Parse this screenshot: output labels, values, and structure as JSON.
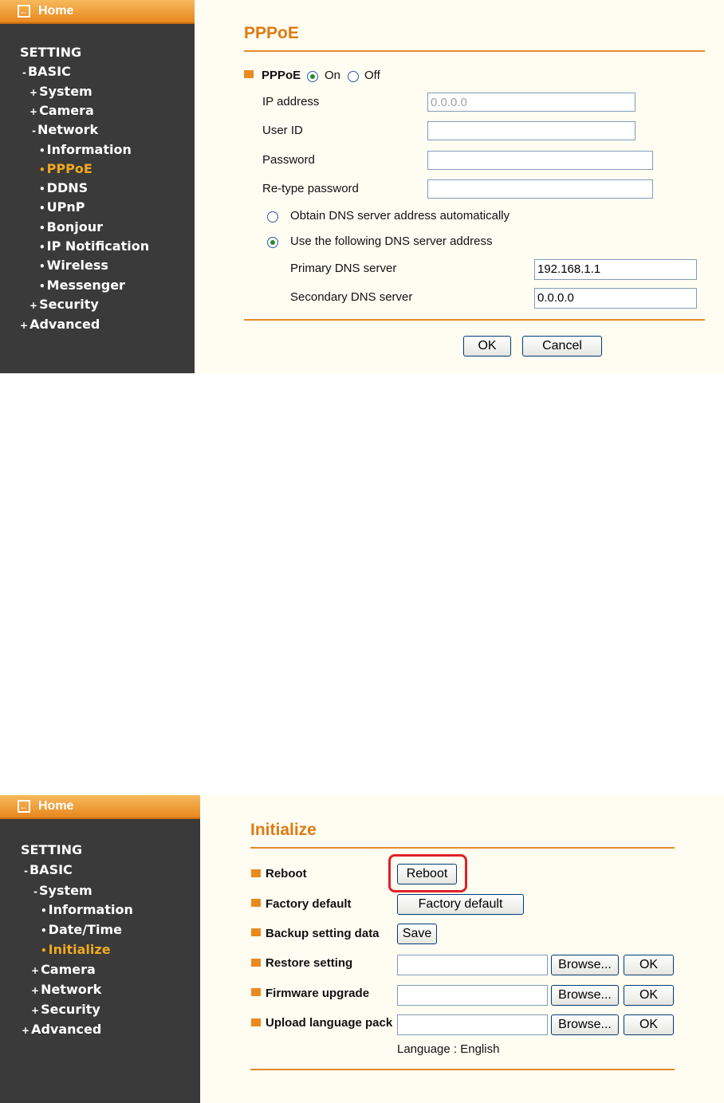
{
  "top": {
    "home_label": "Home",
    "nav": [
      "SETTING",
      "BASIC",
      "System",
      "Camera",
      "Network",
      "Information",
      "PPPoE",
      "DDNS",
      "UPnP",
      "Bonjour",
      "IP Notification",
      "Wireless",
      "Messenger",
      "Security",
      "Advanced"
    ],
    "nav_prefix": [
      "",
      "-",
      "+",
      "+",
      "-",
      "•",
      "•",
      "•",
      "•",
      "•",
      "•",
      "•",
      "•",
      "+",
      "+"
    ],
    "title": "PPPoE",
    "pppoe_label": "PPPoE",
    "on_label": "On",
    "off_label": "Off",
    "pppoe_state": "On",
    "ip_label": "IP address",
    "ip_value": "0.0.0.0",
    "userid_label": "User ID",
    "userid_value": "",
    "password_label": "Password",
    "password_value": "",
    "retype_label": "Re-type password",
    "retype_value": "",
    "dns_auto_label": "Obtain DNS server address automatically",
    "dns_manual_label": "Use the following DNS server address",
    "dns_mode": "manual",
    "primary_label": "Primary DNS server",
    "primary_value": "192.168.1.1",
    "secondary_label": "Secondary DNS server",
    "secondary_value": "0.0.0.0",
    "ok_label": "OK",
    "cancel_label": "Cancel"
  },
  "bottom": {
    "home_label": "Home",
    "nav": [
      "SETTING",
      "BASIC",
      "System",
      "Information",
      "Date/Time",
      "Initialize",
      "Camera",
      "Network",
      "Security",
      "Advanced"
    ],
    "nav_prefix": [
      "",
      "-",
      "-",
      "•",
      "•",
      "•",
      "+",
      "+",
      "+",
      "+"
    ],
    "title": "Initialize",
    "reboot_label": "Reboot",
    "reboot_button": "Reboot",
    "factory_label": "Factory default",
    "factory_button": "Factory default",
    "backup_label": "Backup setting data",
    "save_button": "Save",
    "restore_label": "Restore setting",
    "firmware_label": "Firmware upgrade",
    "language_label": "Upload language pack",
    "browse_label": "Browse...",
    "ok_label": "OK",
    "language_info": "Language : English"
  },
  "colors": {
    "accent": "#e07a12",
    "sidebar_bg": "#3a3a3a",
    "active_nav": "#f2a91e",
    "highlight": "#e0202a"
  }
}
